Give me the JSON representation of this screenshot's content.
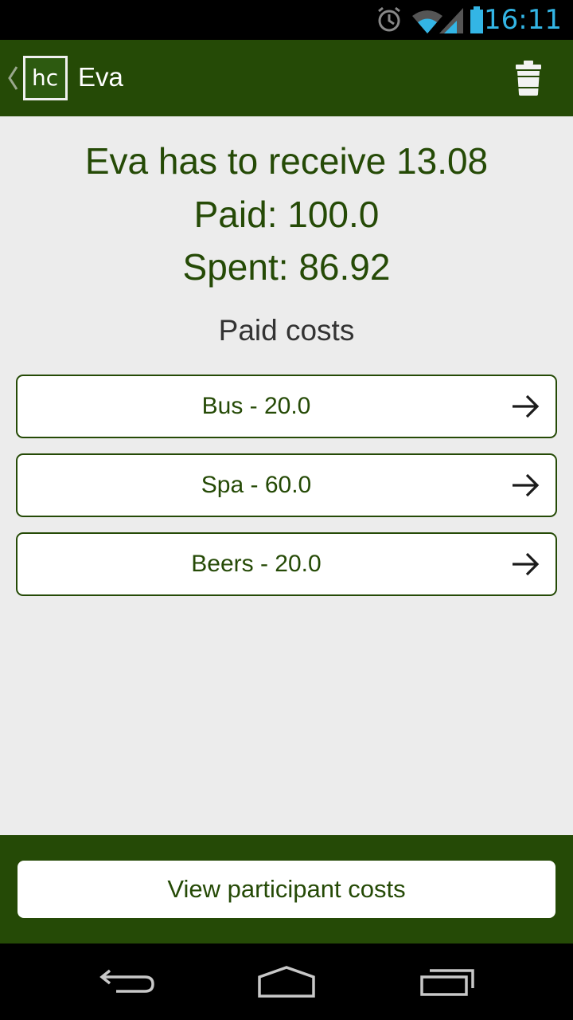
{
  "status_bar": {
    "time": "16:11",
    "icons": [
      "alarm-icon",
      "wifi-icon",
      "signal-icon",
      "battery-icon"
    ],
    "accent_color": "#33b5e5"
  },
  "action_bar": {
    "title": "Eva",
    "logo_text": "hc",
    "background_color": "#254a06",
    "icons": [
      "up-caret-icon",
      "trash-icon"
    ]
  },
  "summary": {
    "balance_line": "Eva has to receive 13.08",
    "paid_line": "Paid: 100.0",
    "spent_line": "Spent: 86.92"
  },
  "paid_costs": {
    "heading": "Paid costs",
    "items": [
      {
        "label": "Bus - 20.0"
      },
      {
        "label": "Spa - 60.0"
      },
      {
        "label": "Beers - 20.0"
      }
    ]
  },
  "footer": {
    "button_label": "View participant costs"
  },
  "nav_bar": {
    "icons": [
      "back-icon",
      "home-icon",
      "recents-icon"
    ]
  }
}
